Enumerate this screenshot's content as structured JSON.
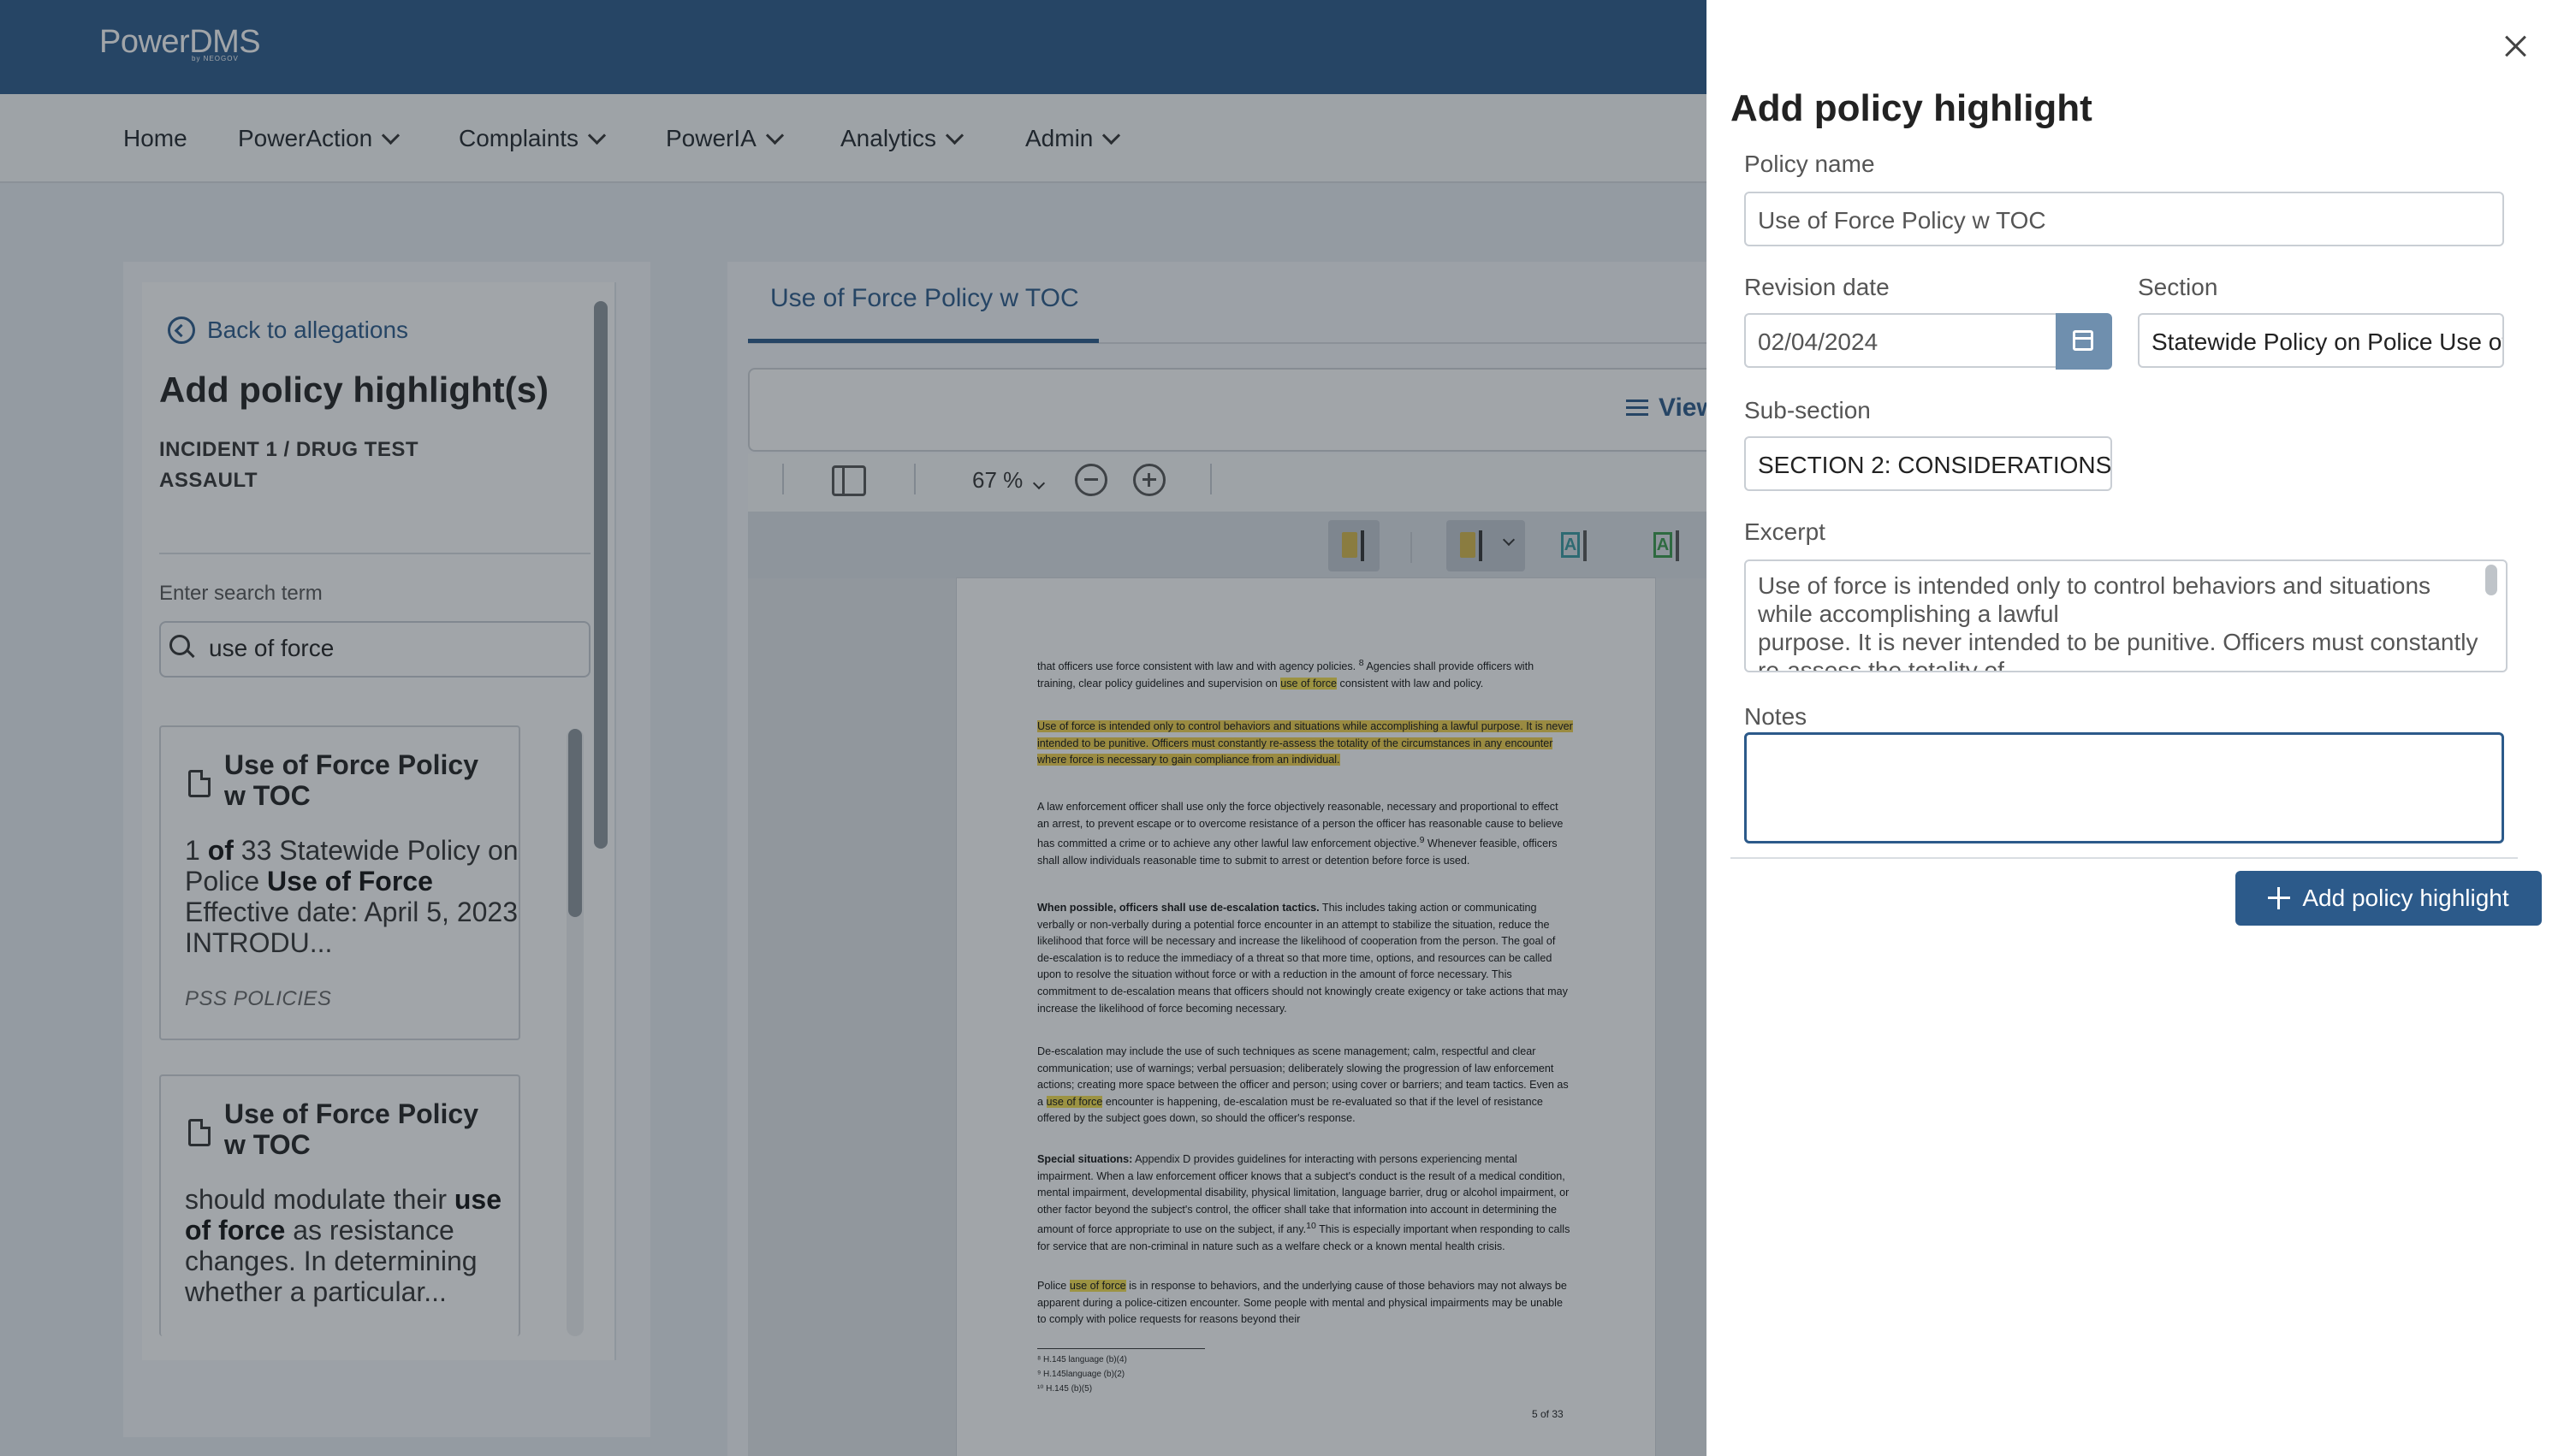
{
  "header": {
    "logo": "PowerDMS",
    "logo_sub": "by NEOGOV",
    "nav": [
      {
        "label": "Home"
      },
      {
        "label": "PowerAction"
      },
      {
        "label": "Complaints"
      },
      {
        "label": "PowerIA"
      },
      {
        "label": "Analytics"
      },
      {
        "label": "Admin"
      }
    ]
  },
  "left": {
    "back": "Back to allegations",
    "title": "Add policy highlight(s)",
    "incident": "INCIDENT 1 / DRUG TEST ASSAULT",
    "search_label": "Enter search term",
    "search_value": "use of force",
    "results": [
      {
        "title": "Use of Force Policy w TOC",
        "body_html": "1 <b>of</b> 33 Statewide Policy on Police <b>Use of Force</b> Effective date: April 5, 2023 INTRODU...",
        "tag": "PSS POLICIES"
      },
      {
        "title": "Use of Force Policy w TOC",
        "body_html": "should modulate their <b>use of force</b> as resistance changes. In determining whether a particular..."
      }
    ]
  },
  "viewer": {
    "tab": "Use of Force Policy w TOC",
    "view_label": "View",
    "zoom": "67 %",
    "page_indicator": "5 of 33",
    "colors": {
      "highlight": "#f3d24c"
    },
    "paragraphs": [
      "that officers use force consistent with law and with agency policies. <sup>8</sup> Agencies shall provide officers with training, clear policy guidelines and supervision on <span class='hl-text'>use of force</span> consistent with law and policy.",
      "<span class='hl'>Use of force is intended only to control behaviors and situations while accomplishing a lawful purpose. It is never intended to be punitive. Officers must constantly re-assess the totality of the circumstances in any encounter where force is necessary to gain compliance from an individual.</span>",
      "A law enforcement officer shall use only the force objectively reasonable, necessary and proportional to effect an arrest, to prevent escape or to overcome resistance of a person the officer has reasonable cause to believe has committed a crime or to achieve any other lawful law enforcement objective.<sup>9</sup> Whenever feasible, officers shall allow individuals reasonable time to submit to arrest or detention before force is used.",
      "<b>When possible, officers shall use de-escalation tactics.</b> This includes taking action or communicating verbally or non-verbally during a potential force encounter in an attempt to stabilize the situation, reduce the likelihood that force will be necessary and increase the likelihood of cooperation from the person. The goal of de-escalation is to reduce the immediacy of a threat so that more time, options, and resources can be called upon to resolve the situation without force or with a reduction in the amount of force necessary. This commitment to de-escalation means that officers should not knowingly create exigency or take actions that may increase the likelihood of force becoming necessary.",
      "De-escalation may include the use of such techniques as scene management; calm, respectful and clear communication; use of warnings; verbal persuasion; deliberately slowing the progression of law enforcement actions; creating more space between the officer and person; using cover or barriers; and team tactics. Even as a <span class='hl-text'>use of force</span> encounter is happening, de-escalation must be re-evaluated so that if the level of resistance offered by the subject goes down, so should the officer's response.",
      "<b>Special situations:</b> Appendix D provides guidelines for interacting with persons experiencing mental impairment. When a law enforcement officer knows that a subject's conduct is the result of a medical condition, mental impairment, developmental disability, physical limitation, language barrier, drug or alcohol impairment, or other factor beyond the subject's control, the officer shall take that information into account in determining the amount of force appropriate to use on the subject, if any.<sup>10</sup> This is especially important when responding to calls for service that are non-criminal in nature such as a welfare check or a known mental health crisis.",
      "Police <span class='hl-text'>use of force</span> is in response to behaviors, and the underlying cause of those behaviors may not always be apparent during a police-citizen encounter. Some people with mental and physical impairments may be unable to comply with police requests for reasons beyond their"
    ],
    "footnotes": [
      "⁸ H.145 language (b)(4)",
      "⁹ H.145language (b)(2)",
      "¹⁰ H.145 (b)(5)"
    ]
  },
  "drawer": {
    "title": "Add policy highlight",
    "policy_name_label": "Policy name",
    "policy_name_value": "Use of Force Policy w TOC",
    "revision_label": "Revision date",
    "revision_value": "02/04/2024",
    "section_label": "Section",
    "section_value": "Statewide Policy on Police Use of Force",
    "subsection_label": "Sub-section",
    "subsection_value": "SECTION 2: CONSIDERATIONS",
    "excerpt_label": "Excerpt",
    "excerpt_value": "Use of force is intended only to control behaviors and situations while accomplishing a lawful\npurpose. It is never intended to be punitive. Officers must constantly re-assess the totality of",
    "notes_label": "Notes",
    "notes_value": "",
    "submit_label": "Add policy highlight"
  }
}
